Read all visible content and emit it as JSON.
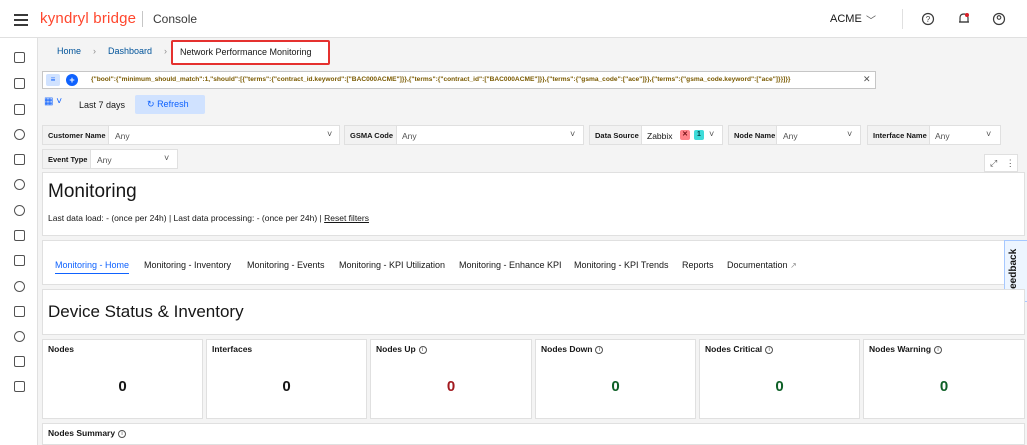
{
  "header": {
    "brand_part1": "kyndryl",
    "brand_part2": "bridge",
    "console": "Console",
    "org": "ACME"
  },
  "breadcrumb": {
    "home": "Home",
    "dashboard": "Dashboard",
    "current": "Network Performance Monitoring"
  },
  "query": "{\"bool\":{\"minimum_should_match\":1,\"should\":[{\"terms\":{\"contract_id.keyword\":[\"BAC000ACME\"]}},{\"terms\":{\"contract_id\":[\"BAC000ACME\"]}},{\"terms\":{\"gsma_code\":[\"ace\"]}},{\"terms\":{\"gsma_code.keyword\":[\"ace\"]}}]}}",
  "time": {
    "range": "Last 7 days",
    "refresh": "Refresh"
  },
  "filters": {
    "customer_name": {
      "label": "Customer Name",
      "value": "Any"
    },
    "gsma_code": {
      "label": "GSMA Code",
      "value": "Any"
    },
    "data_source": {
      "label": "Data Source",
      "value": "Zabbix",
      "badge1": "✕",
      "badge2": "1"
    },
    "node_name": {
      "label": "Node Name",
      "value": "Any"
    },
    "interface_name": {
      "label": "Interface Name",
      "value": "Any"
    },
    "event_type": {
      "label": "Event Type",
      "value": "Any"
    }
  },
  "monitoring": {
    "title": "Monitoring",
    "meta": "Last data load: - (once per 24h) | Last data processing: - (once per 24h) | ",
    "reset": "Reset filters"
  },
  "tabs": [
    "Monitoring - Home",
    "Monitoring - Inventory",
    "Monitoring - Events",
    "Monitoring - KPI Utilization",
    "Monitoring - Enhance KPI",
    "Monitoring - KPI Trends",
    "Reports",
    "Documentation"
  ],
  "feedback": "Feedback",
  "section": {
    "title": "Device Status & Inventory"
  },
  "tiles": [
    {
      "label": "Nodes",
      "value": "0",
      "color": "#161616"
    },
    {
      "label": "Interfaces",
      "value": "0",
      "color": "#161616"
    },
    {
      "label": "Nodes Up",
      "value": "0",
      "color": "#a2191f"
    },
    {
      "label": "Nodes Down",
      "value": "0",
      "color": "#0e6027"
    },
    {
      "label": "Nodes Critical",
      "value": "0",
      "color": "#0e6027"
    },
    {
      "label": "Nodes Warning",
      "value": "0",
      "color": "#0e6027"
    }
  ],
  "summary": {
    "label": "Nodes Summary"
  }
}
